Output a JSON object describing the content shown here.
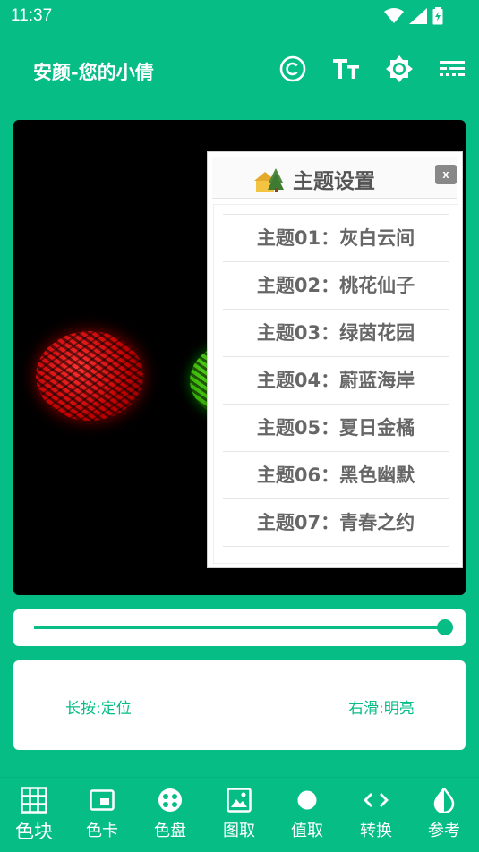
{
  "status_bar": {
    "time": "11:37"
  },
  "app_bar": {
    "title": "安颜-您的小倩"
  },
  "dialog": {
    "title": "主题设置",
    "close_label": "x",
    "themes": [
      {
        "label": "主题01：灰白云间"
      },
      {
        "label": "主题02：桃花仙子"
      },
      {
        "label": "主题03：绿茵花园"
      },
      {
        "label": "主题04：蔚蓝海岸"
      },
      {
        "label": "主题05：夏日金橘"
      },
      {
        "label": "主题06：黑色幽默"
      },
      {
        "label": "主题07：青春之约"
      }
    ]
  },
  "slider": {
    "value_percent": 100
  },
  "info": {
    "hint_left": "长按:定位",
    "hint_right": "右滑:明亮"
  },
  "bottom_nav": {
    "items": [
      {
        "label": "色块",
        "icon": "grid-icon",
        "active": true
      },
      {
        "label": "色卡",
        "icon": "card-icon"
      },
      {
        "label": "色盘",
        "icon": "palette-icon"
      },
      {
        "label": "图取",
        "icon": "image-icon"
      },
      {
        "label": "值取",
        "icon": "dot-icon"
      },
      {
        "label": "转换",
        "icon": "code-icon"
      },
      {
        "label": "参考",
        "icon": "contrast-icon"
      }
    ]
  },
  "colors": {
    "brand": "#06bd85",
    "sphere_red": "#e00000",
    "sphere_green": "#3bd400"
  }
}
